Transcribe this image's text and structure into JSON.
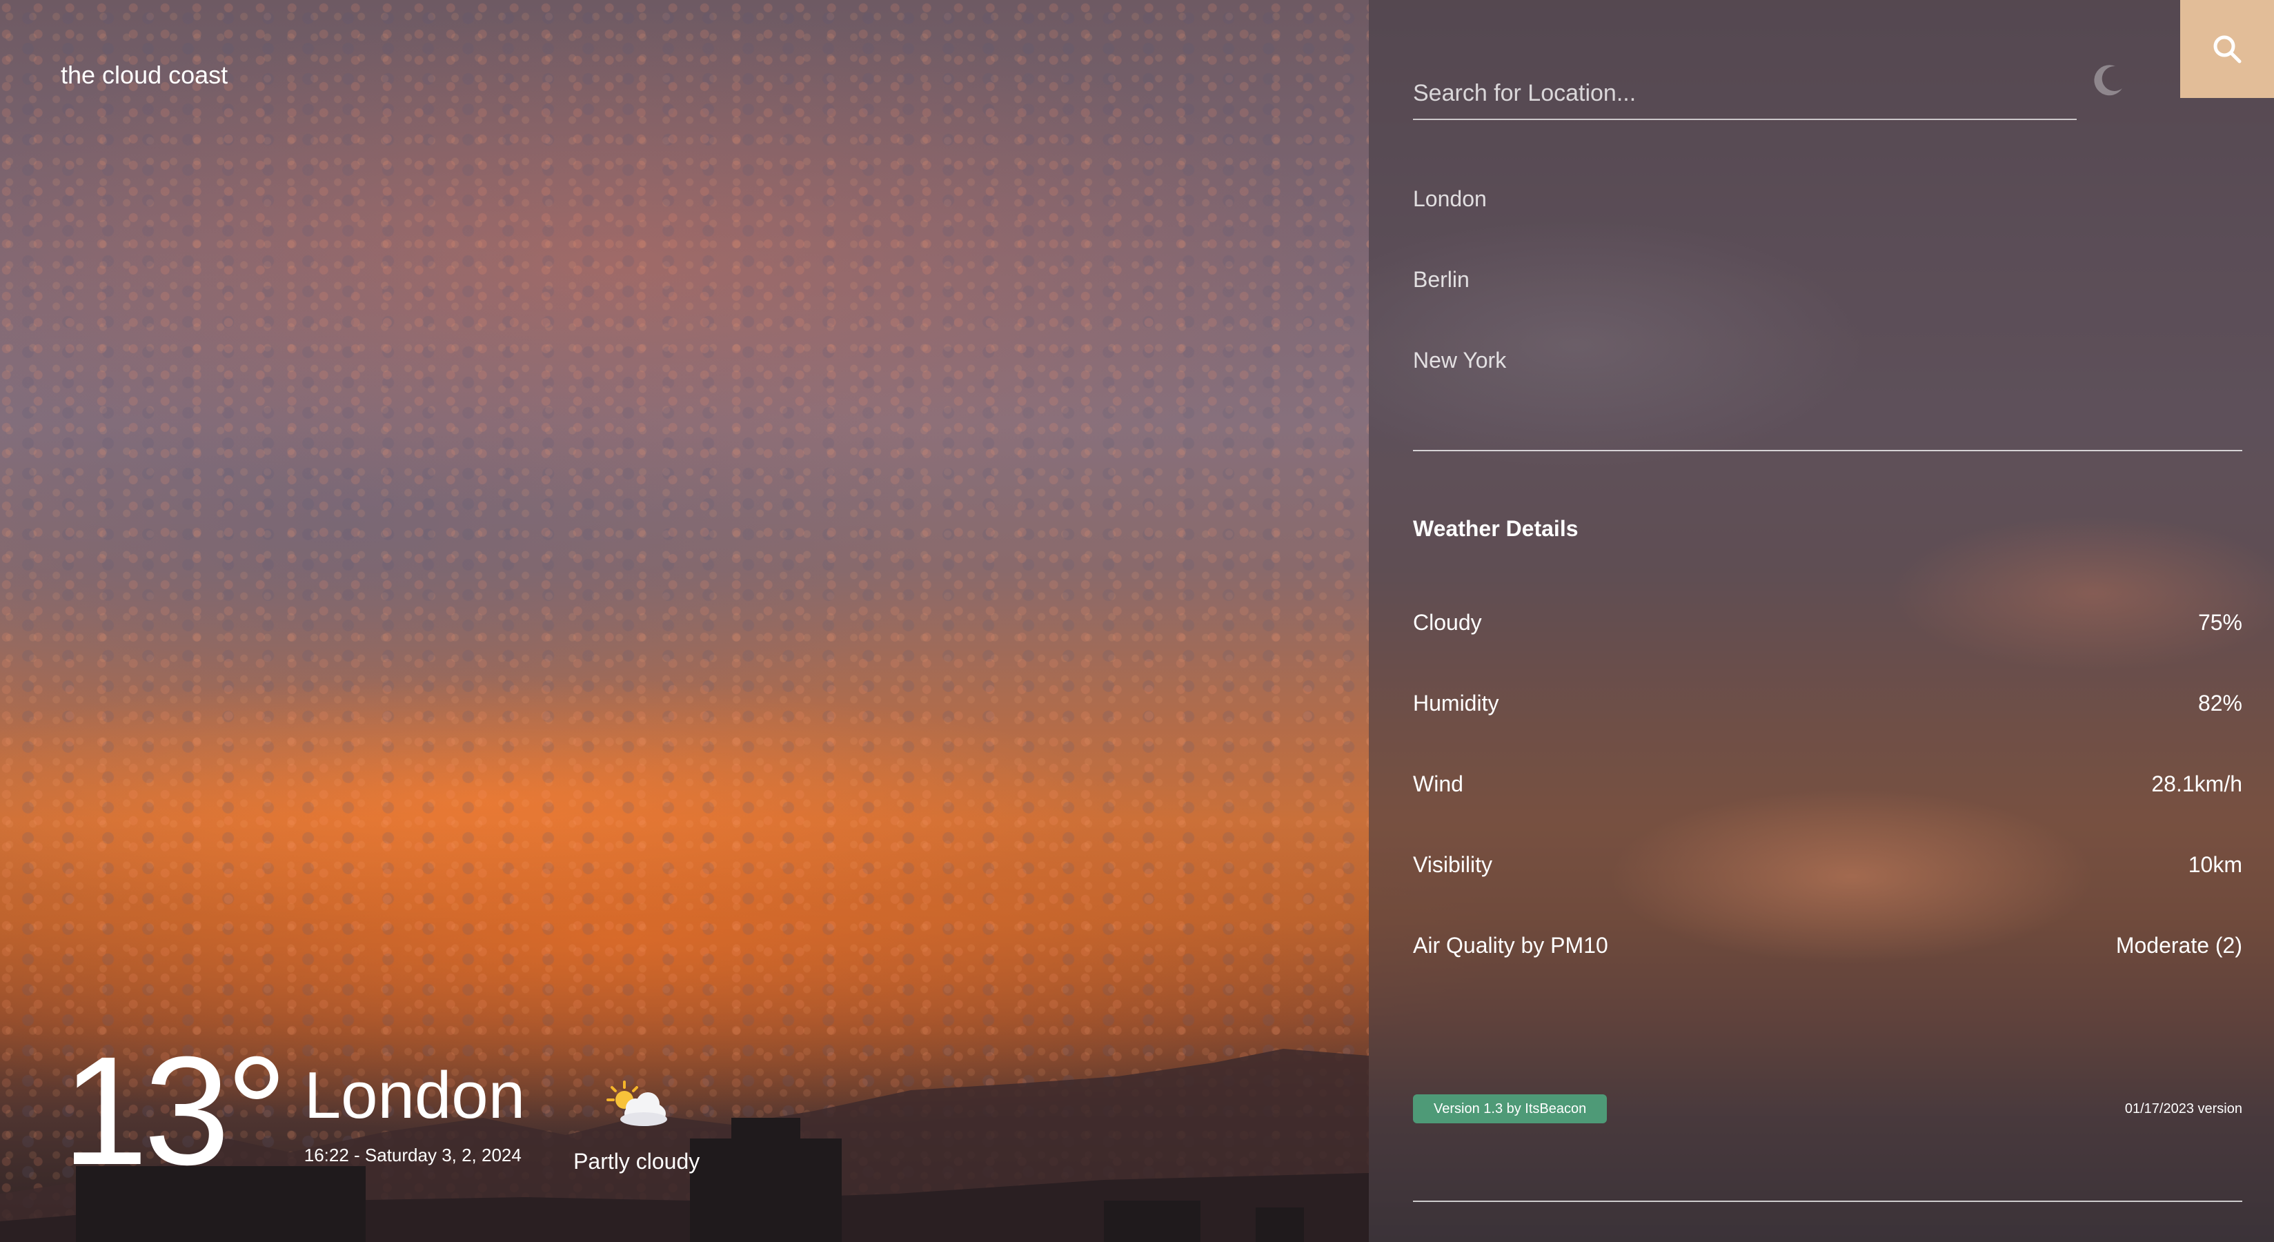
{
  "app": {
    "logo": "the cloud coast"
  },
  "current": {
    "temperature": "13°",
    "city": "London",
    "datetime": "16:22 - Saturday 3, 2, 2024",
    "condition": "Partly cloudy",
    "condition_icon": "partly-cloudy-icon"
  },
  "search": {
    "placeholder": "Search for Location...",
    "button_icon": "search-icon",
    "theme_icon": "moon-icon"
  },
  "locations": [
    "London",
    "Berlin",
    "New York"
  ],
  "details": {
    "title": "Weather Details",
    "rows": [
      {
        "label": "Cloudy",
        "value": "75%"
      },
      {
        "label": "Humidity",
        "value": "82%"
      },
      {
        "label": "Wind",
        "value": "28.1km/h"
      },
      {
        "label": "Visibility",
        "value": "10km"
      },
      {
        "label": "Air Quality by PM10",
        "value": "Moderate (2)"
      }
    ]
  },
  "footer": {
    "version_label": "Version 1.3 by ItsBeacon",
    "version_date": "01/17/2023 version"
  },
  "colors": {
    "accent": "#e2bd98",
    "badge": "#4e9a77"
  }
}
